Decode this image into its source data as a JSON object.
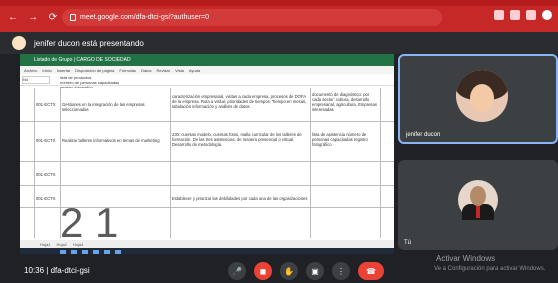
{
  "browser": {
    "url": "meet.google.com/dfa-dtci-gsi?authuser=0"
  },
  "presentation": {
    "presenter_text": "jenifer ducon está presentando"
  },
  "spreadsheet": {
    "window_title": "Listado de Grupo | CARGO DE SOCIEDAD",
    "menu": [
      "Archivo",
      "Inicio",
      "Insertar",
      "Disposición de página",
      "Fórmulas",
      "Datos",
      "Revisar",
      "Vista",
      "Ayuda"
    ],
    "cell_ref": "N4",
    "formula_lines": [
      "lista de productos",
      "número de personas capacitadas",
      "registro fotográfico"
    ],
    "rows": [
      {
        "id": "001-ECTX",
        "desc": "Gestiones en la integración de las empresas seleccionadas",
        "detail": "caracterización empresarial, visitas a cada empresa, procesos de DOFA de la empresa. Ruta a visitar, prioridades de tiempos. Tiempo en mesas, tabulación información y análisis de datos.",
        "evidence": "documento de diagnóstico: por cada sector: cultura, desarrollo empresarial, agricultura, Empresas interesadas"
      },
      {
        "id": "001-ECTX",
        "desc": "Realizar talleres informativos en temas de marketing",
        "detail": "230: cuentas modelo, cuentas fotos, malla curricular de los talleres de formación. De las tres asistencias, de manera presencial o virtual. Desarrollo de metodología.",
        "evidence": "lista de asistencia número de personas capacitadas registro fotográfico"
      },
      {
        "id": "001-ECTX",
        "desc": "",
        "detail": "",
        "evidence": ""
      },
      {
        "id": "001-ECTX",
        "desc": "",
        "detail": "Establecer y priorizar las debilidades por cada una de las organizaciones",
        "evidence": ""
      }
    ],
    "sheet_tabs": [
      "Hoja1",
      "Hoja2",
      "Hoja3"
    ],
    "big_overlay": "2 1"
  },
  "participants": [
    {
      "name": "jenifer ducon"
    },
    {
      "name": "Tú"
    }
  ],
  "bottom": {
    "clock": "10:36",
    "meeting_code": "dfa-dtci-gsi",
    "windows_activation": "Activar Windows",
    "windows_activation_sub": "Ve a Configuración para activar Windows."
  }
}
